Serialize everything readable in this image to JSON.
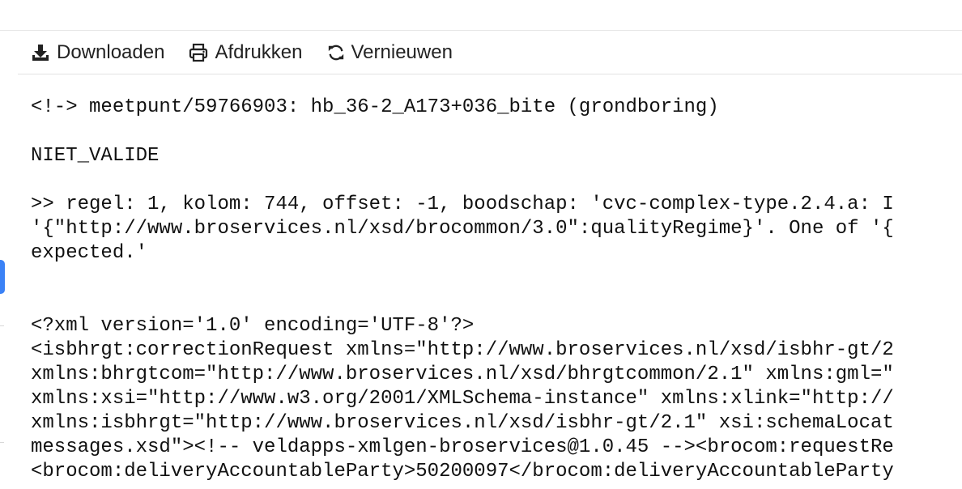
{
  "toolbar": {
    "download_label": "Downloaden",
    "print_label": "Afdrukken",
    "refresh_label": "Vernieuwen"
  },
  "output": {
    "header": "<!-> meetpunt/59766903: hb_36-2_A173+036_bite (grondboring)",
    "status": "NIET_VALIDE",
    "message_lines": [
      ">> regel: 1, kolom: 744, offset: -1, boodschap: 'cvc-complex-type.2.4.a: I",
      "'{\"http://www.broservices.nl/xsd/brocommon/3.0\":qualityRegime}'. One of '{",
      "expected.'"
    ],
    "xml_lines": [
      "<?xml version='1.0' encoding='UTF-8'?>",
      "<isbhrgt:correctionRequest xmlns=\"http://www.broservices.nl/xsd/isbhr-gt/2",
      "xmlns:bhrgtcom=\"http://www.broservices.nl/xsd/bhrgtcommon/2.1\" xmlns:gml=\"",
      "xmlns:xsi=\"http://www.w3.org/2001/XMLSchema-instance\" xmlns:xlink=\"http://",
      "xmlns:isbhrgt=\"http://www.broservices.nl/xsd/isbhr-gt/2.1\" xsi:schemaLocat",
      "messages.xsd\"><!-- veldapps-xmlgen-broservices@1.0.45 --><brocom:requestRe",
      "<brocom:deliveryAccountableParty>50200097</brocom:deliveryAccountableParty"
    ]
  },
  "colors": {
    "accent": "#3b82f6",
    "text": "#111111"
  },
  "icons": [
    "download-icon",
    "print-icon",
    "refresh-icon"
  ]
}
